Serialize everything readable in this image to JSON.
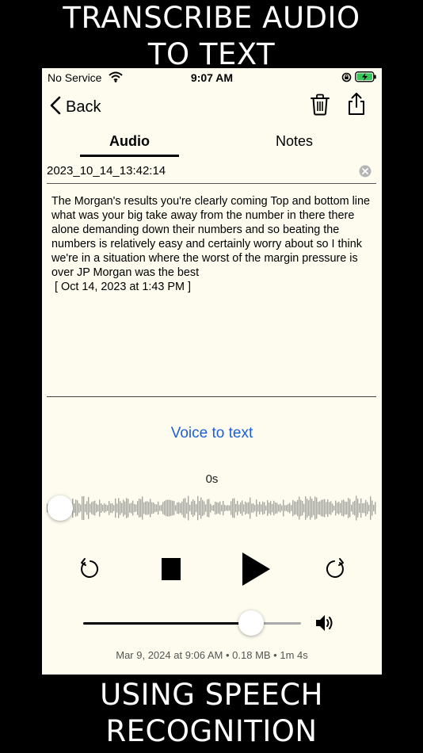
{
  "caption": {
    "top_line1": "TRANSCRIBE AUDIO",
    "top_line2": "TO TEXT",
    "bottom_line1": "USING SPEECH",
    "bottom_line2": "RECOGNITION"
  },
  "status_bar": {
    "carrier": "No Service",
    "time": "9:07 AM",
    "icons": [
      "wifi-icon",
      "orientation-lock-icon",
      "battery-charging-icon"
    ]
  },
  "nav": {
    "back_label": "Back",
    "icons": [
      "chevron-left-icon",
      "trash-icon",
      "share-icon"
    ]
  },
  "tabs": [
    {
      "label": "Audio",
      "selected": true
    },
    {
      "label": "Notes",
      "selected": false
    }
  ],
  "recording": {
    "title_value": "2023_10_14_13:42:14",
    "transcript": "The Morgan's results you're clearly coming Top and bottom line what was your big take away from the number in there there alone demanding down their numbers and so beating the numbers is relatively easy and certainly worry about so I think we're in a situation where the worst of the margin pressure is over JP Morgan was the best\n [ Oct 14, 2023 at 1:43 PM ]"
  },
  "voice_to_text_label": "Voice to text",
  "player": {
    "elapsed": "0s",
    "playhead_fraction": 0,
    "volume_fraction": 0.77,
    "controls": [
      "rewind-icon",
      "stop-icon",
      "play-icon",
      "forward-icon",
      "speaker-icon"
    ]
  },
  "meta": "Mar 9, 2024 at 9:06 AM • 0.18 MB • 1m 4s",
  "colors": {
    "background": "#fdfcef",
    "accent_link": "#1f5fd6",
    "waveform": "#a6a6a6",
    "battery_fill": "#34c759"
  }
}
